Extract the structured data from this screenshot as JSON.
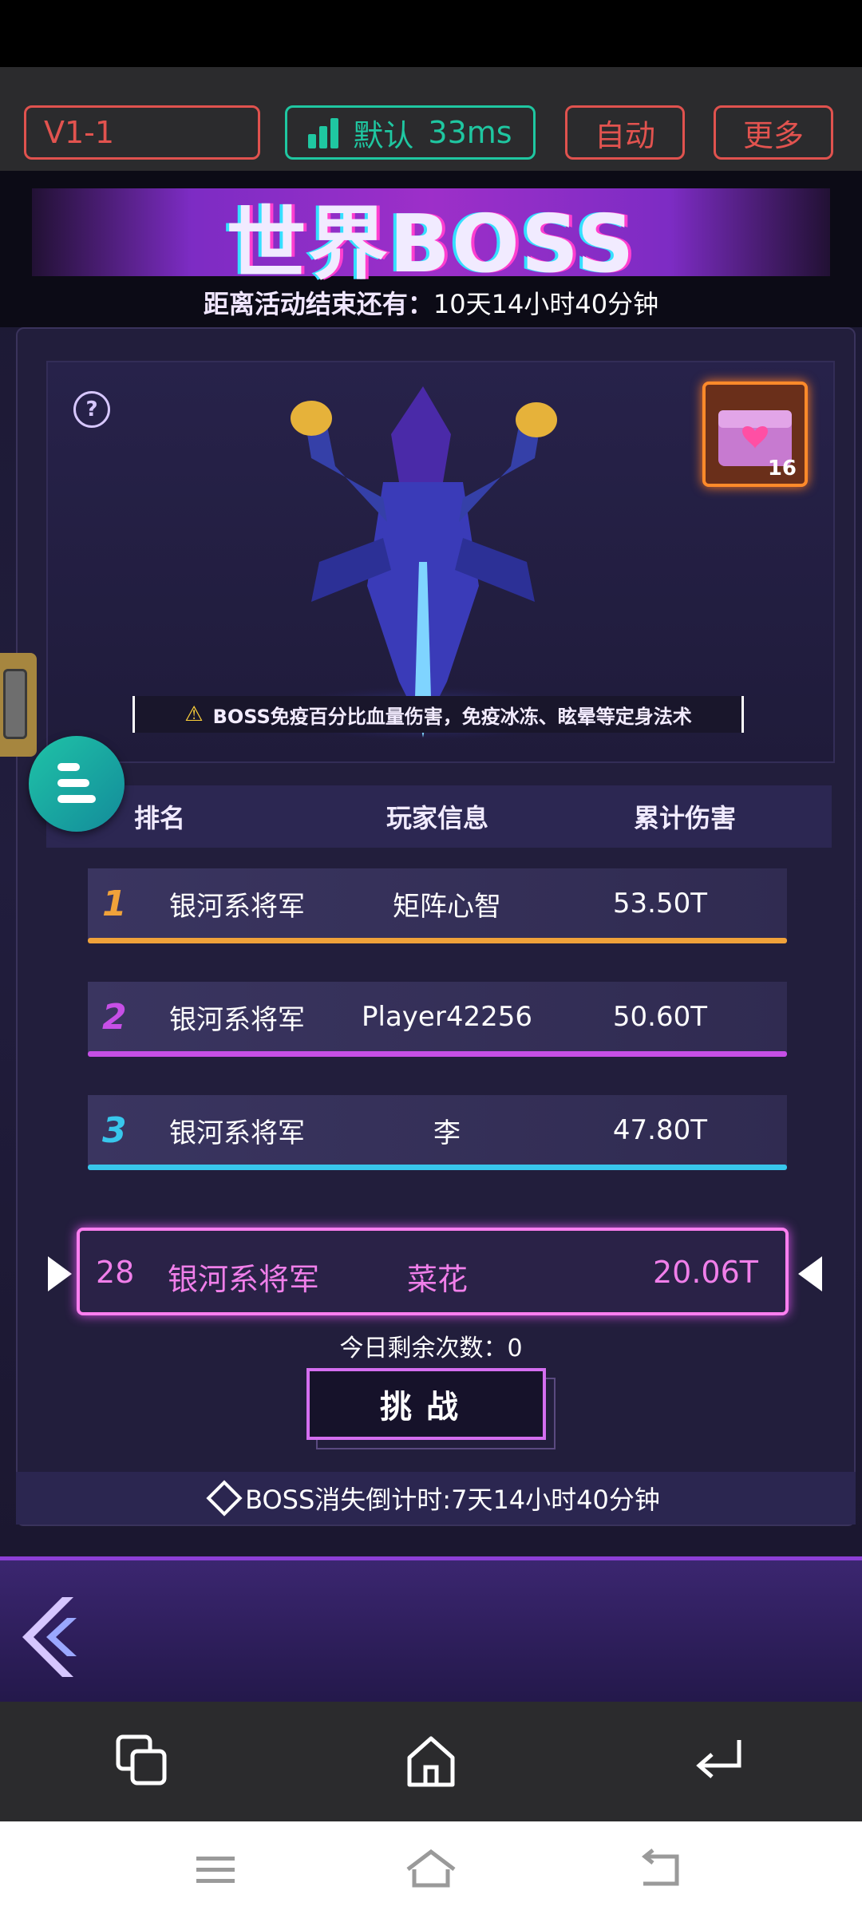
{
  "top_bar": {
    "version": "V1-1",
    "network_label": "默认",
    "latency": "33ms",
    "auto_label": "自动",
    "more_label": "更多",
    "network_color": "#1fc7a1",
    "accent_color": "#e0524e"
  },
  "banner": {
    "title": "世界BOSS",
    "countdown_label": "距离活动结束还有：",
    "countdown_value": "10天14小时40分钟"
  },
  "boss": {
    "chest_count": "16",
    "notice": "BOSS免疫百分比血量伤害，免疫冰冻、眩晕等定身法术",
    "help_icon": "question-icon",
    "chest_icon": "treasure-chest-icon"
  },
  "ranking": {
    "headers": {
      "rank": "排名",
      "player": "玩家信息",
      "damage": "累计伤害"
    },
    "rows": [
      {
        "rank": "1",
        "title": "银河系将军",
        "player": "矩阵心智",
        "damage": "53.50T",
        "color": "#f0a23a"
      },
      {
        "rank": "2",
        "title": "银河系将军",
        "player": "Player42256",
        "damage": "50.60T",
        "color": "#c64fe6"
      },
      {
        "rank": "3",
        "title": "银河系将军",
        "player": "李",
        "damage": "47.80T",
        "color": "#38c7ec"
      }
    ],
    "me": {
      "rank": "28",
      "title": "银河系将军",
      "player": "菜花",
      "damage": "20.06T"
    }
  },
  "actions": {
    "remaining_label": "今日剩余次数：",
    "remaining_value": "0",
    "challenge_label": "挑战"
  },
  "footer": {
    "disappear_text": "BOSS消失倒计时:7天14小时40分钟"
  },
  "nav": {
    "app": [
      "copy-icon",
      "home-icon",
      "back-icon"
    ],
    "system": [
      "menu-icon",
      "home-icon",
      "back-icon"
    ]
  }
}
